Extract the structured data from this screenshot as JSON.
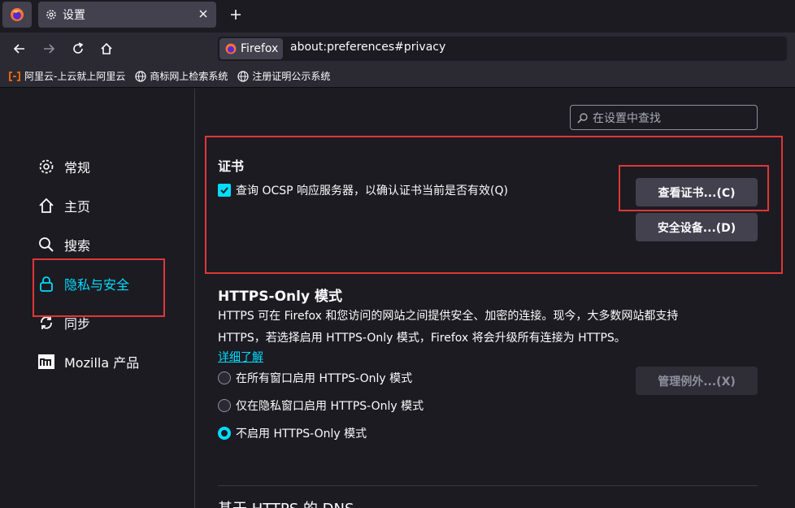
{
  "tabs": {
    "active_tab_title": "设置"
  },
  "nav": {
    "identity_label": "Firefox",
    "url": "about:preferences#privacy"
  },
  "bookmarks": [
    {
      "label": "阿里云-上云就上阿里云"
    },
    {
      "label": "商标网上检索系统"
    },
    {
      "label": "注册证明公示系统"
    }
  ],
  "search": {
    "placeholder": "在设置中查找"
  },
  "sidebar": {
    "items": [
      {
        "label": "常规",
        "icon": "gear-icon"
      },
      {
        "label": "主页",
        "icon": "home-icon"
      },
      {
        "label": "搜索",
        "icon": "search-icon"
      },
      {
        "label": "隐私与安全",
        "icon": "lock-icon"
      },
      {
        "label": "同步",
        "icon": "sync-icon"
      },
      {
        "label": "Mozilla 产品",
        "icon": "mozilla-icon"
      }
    ]
  },
  "certificates": {
    "heading": "证书",
    "ocsp_label": "查询 OCSP 响应服务器，以确认证书当前是否有效(Q)",
    "view_button": "查看证书...(C)",
    "devices_button": "安全设备...(D)"
  },
  "https_only": {
    "heading": "HTTPS-Only 模式",
    "desc_line1": "HTTPS 可在 Firefox 和您访问的网站之间提供安全、加密的连接。现今，大多数网站都支持",
    "desc_line2": "HTTPS，若选择启用 HTTPS-Only 模式，Firefox 将会升级所有连接为 HTTPS。",
    "learn_more": "详细了解",
    "options": [
      {
        "label": "在所有窗口启用 HTTPS-Only 模式",
        "selected": false
      },
      {
        "label": "仅在隐私窗口启用 HTTPS-Only 模式",
        "selected": false
      },
      {
        "label": "不启用 HTTPS-Only 模式",
        "selected": true
      }
    ],
    "exceptions_button": "管理例外...(X)"
  },
  "dns": {
    "heading": "基于 HTTPS 的 DNS"
  },
  "colors": {
    "accent": "#00ddff",
    "highlight_red": "#e13636"
  }
}
